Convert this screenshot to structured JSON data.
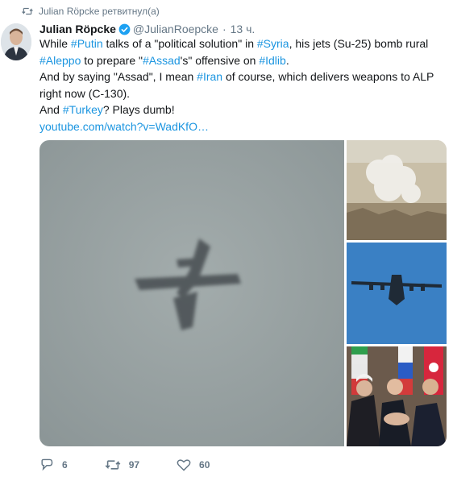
{
  "retweet_context": {
    "text": "Julian Röpcke ретвитнул(а)",
    "icon": "retweet-icon"
  },
  "tweet": {
    "author_name": "Julian Röpcke",
    "verified_icon": "verified-badge-icon",
    "handle": "@JulianRoepcke",
    "separator": "·",
    "time": "13 ч.",
    "line1": {
      "t1": "While ",
      "h1": "#Putin",
      "t2": " talks of a \"political solution\" in ",
      "h2": "#Syria",
      "t3": ", his jets (Su-25) bomb rural"
    },
    "line2": {
      "h1": "#Aleppo",
      "t1": " to prepare \"",
      "h2": "#Assad",
      "t2": "'s\" offensive on ",
      "h3": "#Idlib",
      "t3": "."
    },
    "line3": {
      "t1": "And by saying \"Assad\", I mean ",
      "h1": "#Iran",
      "t2": " of course, which delivers weapons to ALP"
    },
    "line4": "right now (C-130).",
    "line5": {
      "t1": "And ",
      "h1": "#Turkey",
      "t2": "? Plays dumb!"
    },
    "link": "youtube.com/watch?v=WadKfO…"
  },
  "media": {
    "main": "jet-aircraft-in-sky-photo",
    "side": [
      "smoke-explosion-photo",
      "c130-transport-plane-photo",
      "leaders-handshake-photo"
    ]
  },
  "actions": {
    "reply_count": "6",
    "retweet_count": "97",
    "like_count": "60"
  },
  "colors": {
    "link": "#1b95e0",
    "secondary": "#657786",
    "text": "#14171a",
    "retweet_icon": "#17bf63"
  }
}
